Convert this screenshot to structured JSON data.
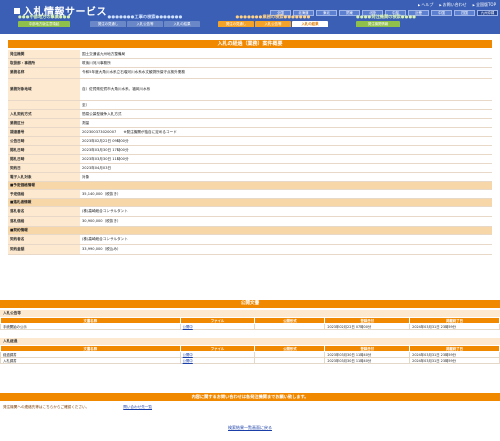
{
  "header": {
    "title": "入札情報サービス",
    "top_links": [
      "ヘルプ",
      "お問い合わせ",
      "全国版TOP"
    ],
    "regions": [
      "全国",
      "北海道",
      "東北",
      "関東",
      "北陸",
      "中部",
      "近畿",
      "中国",
      "四国",
      "九州沖縄"
    ],
    "active_region": "関東",
    "categories": {
      "left": {
        "title": "中部地方の事業",
        "buttons": [
          "中部地方版注意喚起"
        ]
      },
      "mid": {
        "title": "工事の検索",
        "buttons": [
          "発注の見通し",
          "入札公告等",
          "入札の結果"
        ]
      },
      "midside": {
        "title": "業務の検索",
        "buttons": [
          "発注の見通し",
          "入札公告等",
          "入札の結果"
        ],
        "active": "入札の結果"
      },
      "right": {
        "title": "発注機関の検索",
        "buttons": [
          "発注機関情報"
        ]
      }
    }
  },
  "detail": {
    "title": "入札の経過（業務）案件概要",
    "rows": [
      {
        "label": "発注機関",
        "value": "国土交通省九州地方整備局"
      },
      {
        "label": "取扱部・事務所",
        "value": "筑後川河川事務所"
      },
      {
        "label": "業務名称",
        "value": "令和5年度大角川水系立石堰河川水系水文観測所保守点検外業務"
      },
      {
        "label": "業務対象地域",
        "value": "自）佐賀県佐賀市大角川水系、福岡川水系"
      },
      {
        "label": "",
        "value": "至）"
      },
      {
        "label": "入札契約方式",
        "value": "簡易公募型競争入札方式"
      },
      {
        "label": "業務区分",
        "value": "測量"
      },
      {
        "label": "調達番号",
        "value": "202300373020007　　※発注機関が独自に定めるコード"
      },
      {
        "label": "公告日時",
        "value": "2023年02月22日 09時00分"
      },
      {
        "label": "開札日時",
        "value": "2023年03月30日 17時00分"
      },
      {
        "label": "開札日時",
        "value": "2023年03月30日 11時00分"
      },
      {
        "label": "契約日",
        "value": "2023年04月03日"
      },
      {
        "label": "電子入札対象",
        "value": "対象"
      }
    ],
    "subsections": [
      {
        "title": "■予定価格情報",
        "rows": [
          {
            "label": "予定価格",
            "value": "35,140,000（税抜き）"
          }
        ]
      },
      {
        "title": "■落札者情報",
        "rows": [
          {
            "label": "落札者名",
            "value": "(株)高崎総合コンサルタント"
          },
          {
            "label": "落札価格",
            "value": "30,900,000（税抜き）"
          }
        ]
      },
      {
        "title": "■契約情報",
        "rows": [
          {
            "label": "契約者名",
            "value": "(株)高崎総合コンサルタント"
          },
          {
            "label": "契約金額",
            "value": "33,990,000（税込み）"
          }
        ]
      }
    ]
  },
  "notices": {
    "title": "公開文書",
    "columns": [
      "文書名称",
      "ファイル",
      "公開形式",
      "登録日付",
      "掲載終了日"
    ],
    "groups": [
      {
        "title": "入札公告等",
        "rows": [
          {
            "name": "手続開始の公示",
            "file": "公開中",
            "format": "",
            "registered": "2023年02月22日 07時00分",
            "end": "2024年03月31日 23時59分"
          }
        ]
      },
      {
        "title": "入札経過",
        "rows": [
          {
            "name": "経過調書",
            "file": "公開中",
            "format": "",
            "registered": "2023年03月30日 11時40分",
            "end": "2024年03月31日 23時59分"
          },
          {
            "name": "入札調書",
            "file": "公開中",
            "format": "",
            "registered": "2023年03月30日 11時40分",
            "end": "2024年03月31日 23時59分"
          }
        ]
      }
    ]
  },
  "footer": {
    "contact_bar": "内容に関するお問い合わせは各発注機関までお願い致します。",
    "contact_text": "発注機関への連絡先等はこちらからご確認ください。",
    "contact_link": "問い合わせ先一覧",
    "back_link": "検索結果一覧画面に戻る"
  },
  "colors": {
    "header_blue": "#3a5fb4",
    "accent_orange": "#f08800",
    "label_bg": "#fde9cf",
    "green": "#8fc04b"
  }
}
